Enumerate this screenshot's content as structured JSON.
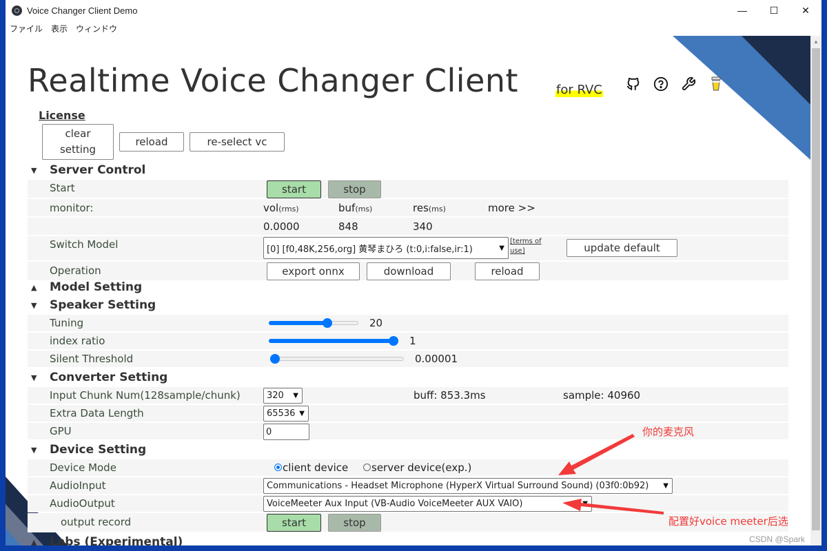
{
  "window": {
    "title": "Voice Changer Client Demo",
    "controls": {
      "minimize": "—",
      "maximize": "☐",
      "close": "✕"
    }
  },
  "menu": [
    "ファイル",
    "表示",
    "ウィンドウ"
  ],
  "header": {
    "title": "Realtime Voice Changer Client",
    "subtitle": "for RVC",
    "icons": [
      "github-icon",
      "help-icon",
      "wrench-icon",
      "coffee-icon"
    ],
    "license_link": "License",
    "buttons": {
      "clear_line1": "clear",
      "clear_line2": "setting",
      "reload": "reload",
      "reselect": "re-select vc"
    }
  },
  "server_control": {
    "title": "Server Control",
    "start_label": "Start",
    "start_btn": "start",
    "stop_btn": "stop",
    "monitor_label": "monitor:",
    "monitor": {
      "vol_label": "vol",
      "vol_unit": "(rms)",
      "vol_value": "0.0000",
      "buf_label": "buf",
      "buf_unit": "(ms)",
      "buf_value": "848",
      "res_label": "res",
      "res_unit": "(ms)",
      "res_value": "340",
      "more": "more >>"
    },
    "switch_model_label": "Switch Model",
    "model_selected": "[0] [f0,48K,256,org] 黄琴まひろ (t:0,i:false,ir:1)",
    "terms_line1": "[terms of",
    "terms_line2": "use]",
    "update_default": "update default",
    "operation_label": "Operation",
    "ops": {
      "export": "export onnx",
      "download": "download",
      "reload": "reload"
    }
  },
  "model_setting": {
    "title": "Model Setting",
    "collapsed": true
  },
  "speaker_setting": {
    "title": "Speaker Setting",
    "tuning": {
      "label": "Tuning",
      "value": "20",
      "fraction": 0.67
    },
    "index_ratio": {
      "label": "index ratio",
      "value": "1",
      "fraction": 1.0
    },
    "silent_threshold": {
      "label": "Silent Threshold",
      "value": "0.00001",
      "fraction": 0.0
    }
  },
  "converter_setting": {
    "title": "Converter Setting",
    "input_chunk_label": "Input Chunk Num(128sample/chunk)",
    "input_chunk_value": "320",
    "buff": "buff: 853.3ms",
    "sample": "sample: 40960",
    "extra_label": "Extra Data Length",
    "extra_value": "65536",
    "gpu_label": "GPU",
    "gpu_value": "0"
  },
  "device_setting": {
    "title": "Device Setting",
    "mode_label": "Device Mode",
    "mode_client": "client device",
    "mode_server": "server device(exp.)",
    "mode_selected": "client",
    "input_label": "AudioInput",
    "input_value": "Communications - Headset Microphone (HyperX Virtual Surround Sound) (03f0:0b92)",
    "output_label": "AudioOutput",
    "output_value": "VoiceMeeter Aux Input (VB-Audio VoiceMeeter AUX VAIO)",
    "record_label": "output record",
    "record_start": "start",
    "record_stop": "stop"
  },
  "labs": {
    "title": "Labs (Experimental)",
    "collapsed": true
  },
  "annotations": {
    "mic": "你的麦克风",
    "voicemeeter": "配置好voice meeter后选",
    "color": "#f23a3a"
  },
  "watermark": "CSDN @Spark",
  "colors": {
    "accent": "#0075ff",
    "start_green": "#a8dca8",
    "stop_gray": "#a9b9a9",
    "deco_blue": "#4178bc",
    "deco_navy": "#1c2d4c"
  }
}
